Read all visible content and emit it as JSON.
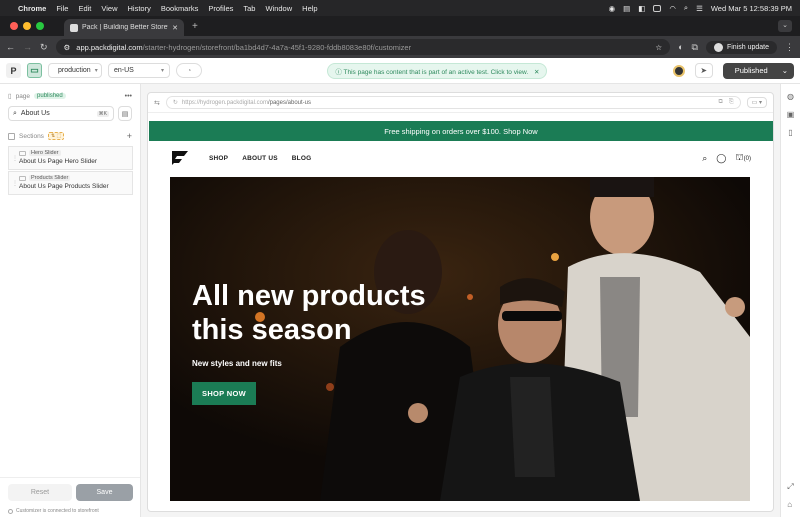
{
  "menubar": {
    "app": "Chrome",
    "items": [
      "File",
      "Edit",
      "View",
      "History",
      "Bookmarks",
      "Profiles",
      "Tab",
      "Window",
      "Help"
    ],
    "clock": "Wed Mar 5  12:58:39 PM"
  },
  "browser": {
    "tab_title": "Pack | Building Better Storefr",
    "url_host": "app.packdigital.com",
    "url_path": "/starter-hydrogen/storefront/ba1bd4d7-4a7a-45f1-9280-fddb8083e80f/customizer",
    "finish_update": "Finish update"
  },
  "topbar": {
    "environment": "production",
    "locale": "en-US",
    "notice": "This page has content that is part of an active test. Click to view.",
    "publish_label": "Published"
  },
  "sidebar": {
    "page_label": "page",
    "status_badge": "published",
    "search_value": "About Us",
    "search_shortcut": "⌘K",
    "sections_label": "Sections",
    "sections": [
      {
        "type": "Hero Slider",
        "name": "About Us Page Hero Slider"
      },
      {
        "type": "Products Slider",
        "name": "About Us Page Products Slider"
      }
    ],
    "reset_label": "Reset",
    "save_label": "Save",
    "connection_status": "Customizer is connected to storefront"
  },
  "preview": {
    "url_prefix": "https://hydrogen.packdigital.com",
    "url_path": "/pages/about-us",
    "promo": "Free shipping on orders over $100. Shop Now",
    "nav": [
      "SHOP",
      "ABOUT US",
      "BLOG"
    ],
    "cart_count": "(0)",
    "hero_title": "All new products this season",
    "hero_subtitle": "New styles and new fits",
    "hero_button": "SHOP NOW"
  },
  "colors": {
    "brand_green": "#1b7c55",
    "publish_dark": "#444444"
  }
}
